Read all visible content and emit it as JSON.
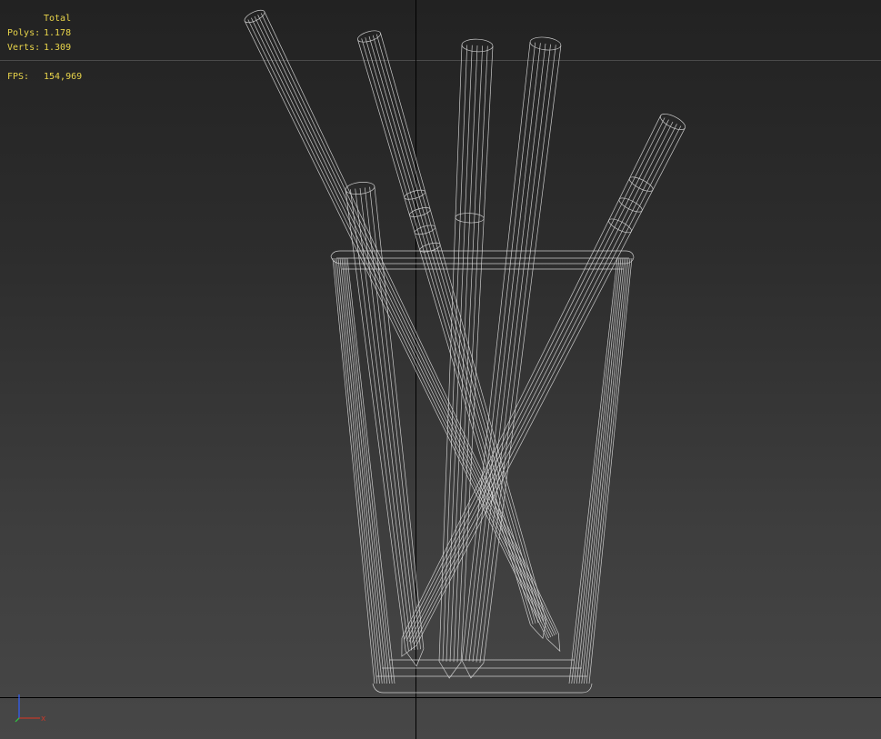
{
  "stats": {
    "header": "Total",
    "polys_label": "Polys:",
    "polys_value": "1.178",
    "verts_label": "Verts:",
    "verts_value": "1.309",
    "fps_label": "FPS:",
    "fps_value": "154,969"
  },
  "gizmo": {
    "x_label": "x"
  },
  "colors": {
    "stats_text": "#e8d44a",
    "wireframe": "#dcdcdc",
    "axis_x": "#c0392b",
    "axis_y": "#2ecc40",
    "axis_z": "#3060ff"
  },
  "scene": {
    "objects": [
      "glass",
      "pencil",
      "pencil",
      "pencil",
      "pencil",
      "marker",
      "pencil"
    ]
  }
}
